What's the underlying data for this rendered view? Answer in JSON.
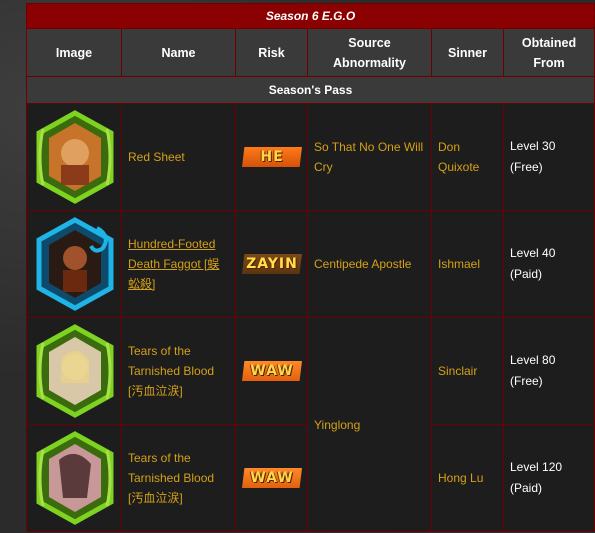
{
  "table": {
    "title": "Season 6 E.G.O",
    "headers": {
      "image": "Image",
      "name": "Name",
      "risk": "Risk",
      "source": "Source Abnormality",
      "sinner": "Sinner",
      "obtained": "Obtained From"
    },
    "section": "Season's Pass",
    "rows": [
      {
        "name": "Red Sheet",
        "risk": "HE",
        "source": "So That No One Will Cry",
        "sinner": "Don Quixote",
        "obtained": "Level 30 (Free)",
        "frame_color": "#7ed321",
        "portrait_color": "#c8732a"
      },
      {
        "name": "Hundred-Footed Death Faggot [蜈蚣殺]",
        "risk": "ZAYIN",
        "source": "Centipede Apostle",
        "sinner": "Ishmael",
        "obtained": "Level 40 (Paid)",
        "frame_color": "#1fb4e6",
        "portrait_color": "#a0522d"
      },
      {
        "name": "Tears of the Tarnished Blood [汚血泣涙]",
        "risk": "WAW",
        "source": "Yinglong",
        "sinner": "Sinclair",
        "obtained": "Level 80 (Free)",
        "frame_color": "#7ed321",
        "portrait_color": "#e8d28a"
      },
      {
        "name": "Tears of the Tarnished Blood [汚血泣涙]",
        "risk": "WAW",
        "source": "Yinglong",
        "sinner": "Hong Lu",
        "obtained": "Level 120 (Paid)",
        "frame_color": "#7ed321",
        "portrait_color": "#5a3a3a"
      }
    ]
  }
}
